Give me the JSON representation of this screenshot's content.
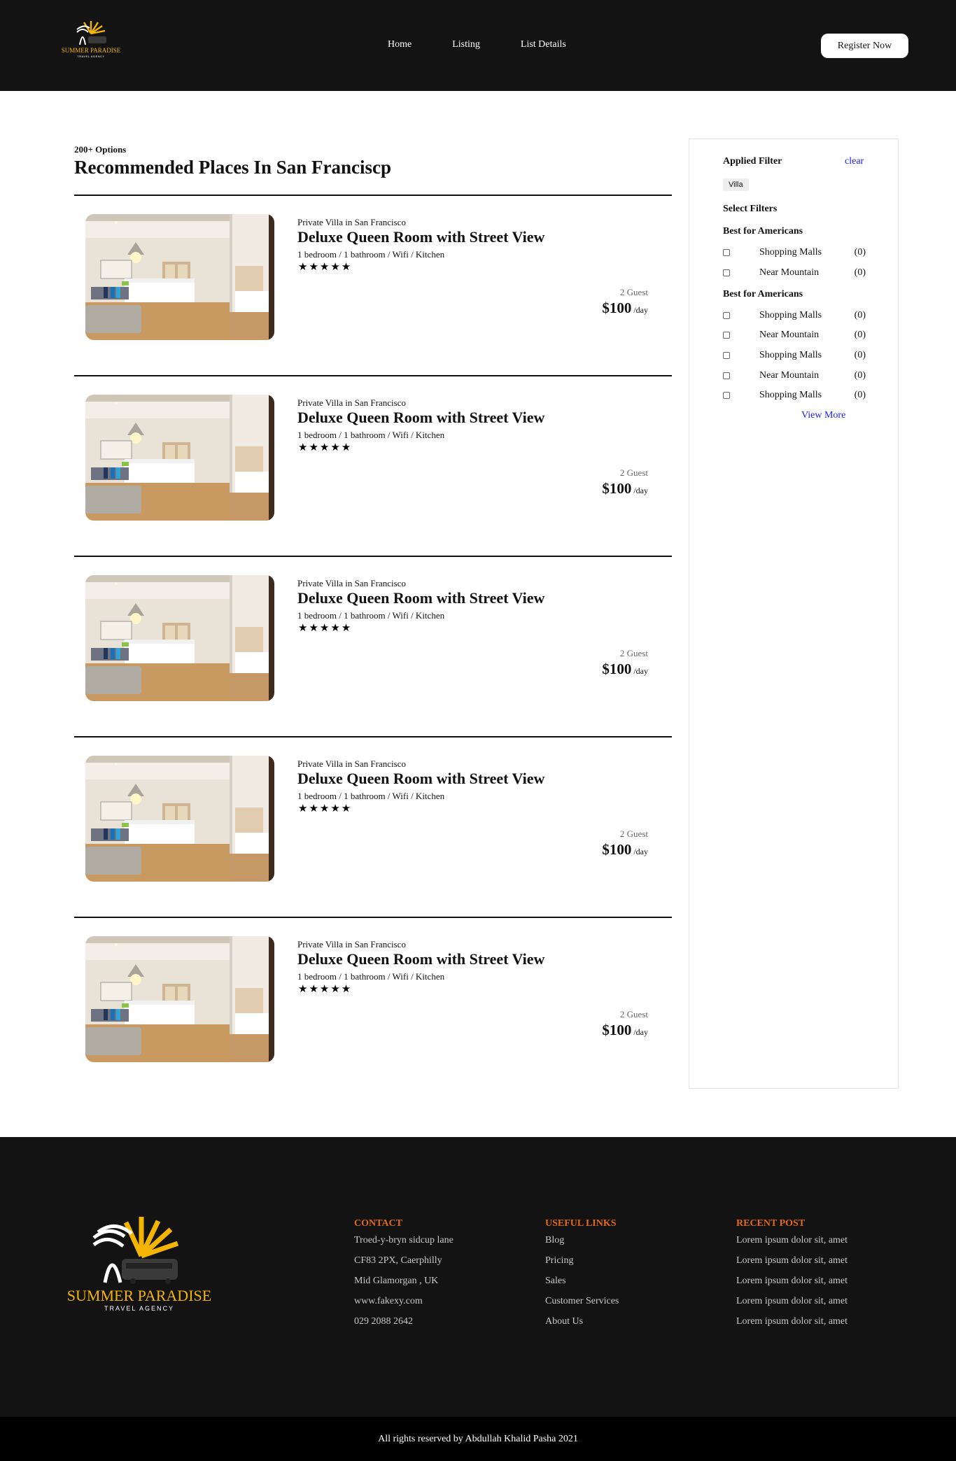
{
  "header": {
    "logo_text": "SUMMER PARADISE",
    "logo_subtext": "TRAVEL AGENCY",
    "nav": [
      "Home",
      "Listing",
      "List Details"
    ],
    "register_label": "Register Now"
  },
  "main": {
    "options_label": "200+ Options",
    "heading": "Recommended Places In San Franciscp",
    "listings": [
      {
        "subtitle": "Private Villa in San Francisco",
        "title": "Deluxe Queen Room with Street View",
        "amenities": "1 bedroom / 1 bathroom / Wifi / Kitchen",
        "stars": "★★★★★",
        "rating": 5,
        "guests": "2 Guest",
        "price": "$100",
        "price_unit": "/day"
      },
      {
        "subtitle": "Private Villa in San Francisco",
        "title": "Deluxe Queen Room with Street View",
        "amenities": "1 bedroom / 1 bathroom / Wifi / Kitchen",
        "stars": "★★★★★",
        "rating": 5,
        "guests": "2 Guest",
        "price": "$100",
        "price_unit": "/day"
      },
      {
        "subtitle": "Private Villa in San Francisco",
        "title": "Deluxe Queen Room with Street View",
        "amenities": "1 bedroom / 1 bathroom / Wifi / Kitchen",
        "stars": "★★★★★",
        "rating": 5,
        "guests": "2 Guest",
        "price": "$100",
        "price_unit": "/day"
      },
      {
        "subtitle": "Private Villa in San Francisco",
        "title": "Deluxe Queen Room with Street View",
        "amenities": "1 bedroom / 1 bathroom / Wifi / Kitchen",
        "stars": "★★★★★",
        "rating": 5,
        "guests": "2 Guest",
        "price": "$100",
        "price_unit": "/day"
      },
      {
        "subtitle": "Private Villa in San Francisco",
        "title": "Deluxe Queen Room with Street View",
        "amenities": "1 bedroom / 1 bathroom / Wifi / Kitchen",
        "stars": "★★★★★",
        "rating": 5,
        "guests": "2 Guest",
        "price": "$100",
        "price_unit": "/day"
      }
    ]
  },
  "sidebar": {
    "applied_label": "Applied Filter",
    "clear_label": "clear",
    "chip": "Villa",
    "select_label": "Select Filters",
    "groups": [
      {
        "title": "Best for Americans",
        "items": [
          {
            "label": "Shopping Malls",
            "count": "(0)"
          },
          {
            "label": "Near Mountain",
            "count": "(0)"
          }
        ]
      },
      {
        "title": "Best for Americans",
        "items": [
          {
            "label": "Shopping Malls",
            "count": "(0)"
          },
          {
            "label": "Near Mountain",
            "count": "(0)"
          },
          {
            "label": "Shopping Malls",
            "count": "(0)"
          },
          {
            "label": "Near Mountain",
            "count": "(0)"
          },
          {
            "label": "Shopping Malls",
            "count": "(0)"
          }
        ]
      }
    ],
    "view_more": "View More"
  },
  "footer": {
    "logo_text": "SUMMER PARADISE",
    "logo_subtext": "TRAVEL AGENCY",
    "contact": {
      "title": "CONTACT",
      "items": [
        "Troed-y-bryn sidcup lane",
        "CF83 2PX, Caerphilly",
        "Mid Glamorgan , UK",
        "www.fakexy.com",
        "029 2088 2642"
      ]
    },
    "links": {
      "title": "USEFUL LINKS",
      "items": [
        "Blog",
        "Pricing",
        "Sales",
        "Customer Services",
        "About Us"
      ]
    },
    "recent": {
      "title": "RECENT POST",
      "items": [
        "Lorem ipsum dolor sit, amet",
        "Lorem ipsum dolor sit, amet",
        "Lorem ipsum dolor sit, amet",
        "Lorem ipsum dolor sit, amet",
        "Lorem ipsum dolor sit, amet"
      ]
    },
    "copyright": "All rights reserved by Abdullah Khalid Pasha 2021"
  },
  "colors": {
    "dark_bg": "#131313",
    "footer_heading": "#e2681c",
    "link_blue": "#1a1aff",
    "logo_gold": "#f4b400"
  }
}
